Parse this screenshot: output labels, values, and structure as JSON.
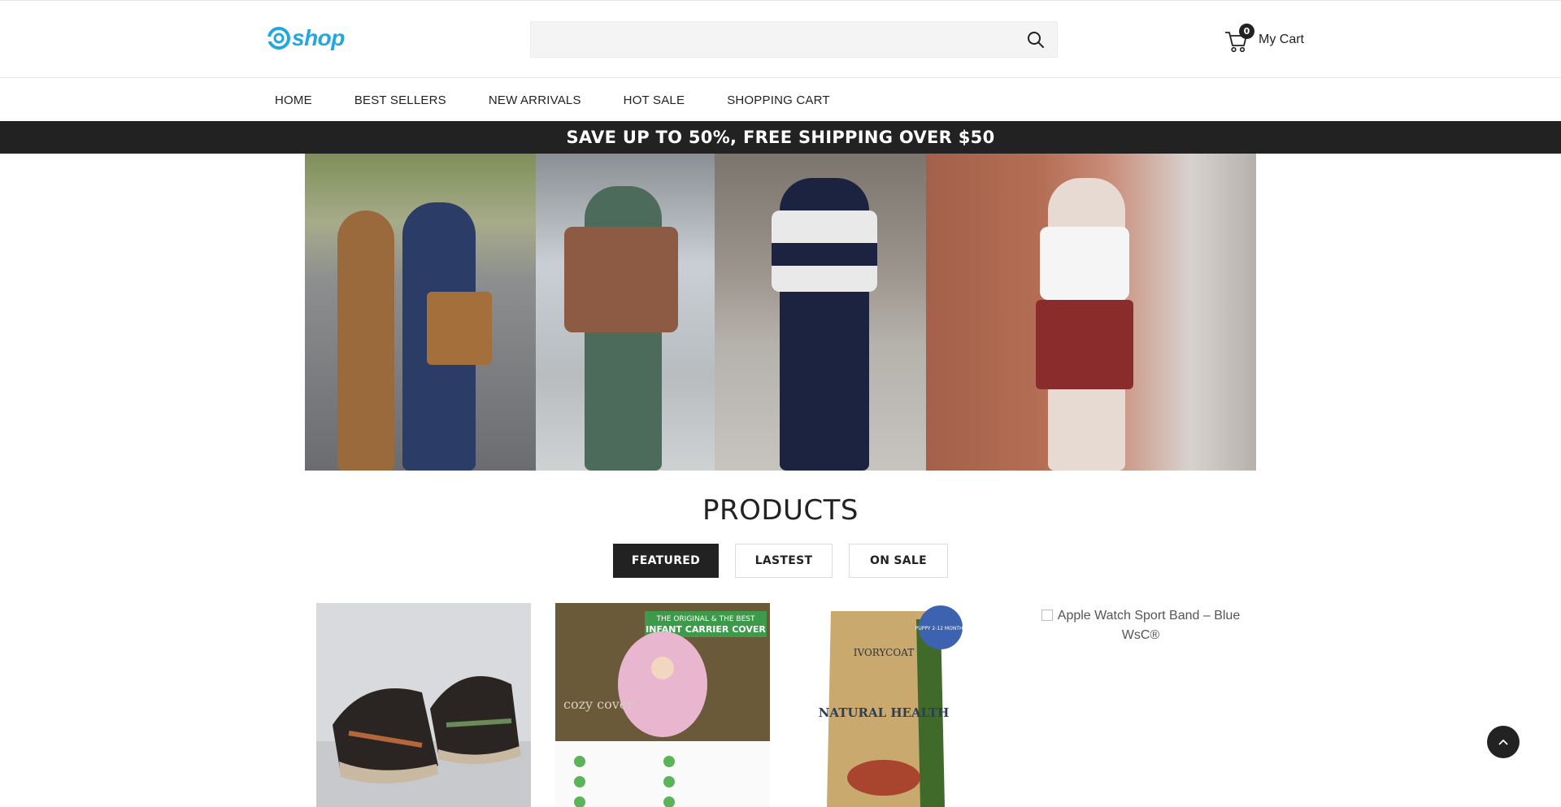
{
  "header": {
    "logo_text": "shop",
    "search": {
      "value": "",
      "placeholder": ""
    },
    "cart": {
      "count": "0",
      "label": "My Cart"
    }
  },
  "nav": {
    "items": [
      {
        "label": "HOME"
      },
      {
        "label": "BEST SELLERS"
      },
      {
        "label": "NEW ARRIVALS"
      },
      {
        "label": "HOT SALE"
      },
      {
        "label": "SHOPPING CART"
      }
    ]
  },
  "promo": {
    "text": "SAVE UP TO 50%, FREE SHIPPING OVER $50"
  },
  "products": {
    "title": "PRODUCTS",
    "tabs": [
      {
        "label": "FEATURED",
        "active": true
      },
      {
        "label": "LASTEST",
        "active": false
      },
      {
        "label": "ON SALE",
        "active": false
      }
    ],
    "cards": [
      {
        "image": "sneakers-photo"
      },
      {
        "image": "infant-carrier-cover-photo",
        "texts": [
          "THE ORIGINAL & THE BEST",
          "INFANT CARRIER COVER",
          "cozy cover"
        ]
      },
      {
        "image": "dog-food-bag-photo",
        "texts": [
          "IVORYCOAT",
          "NATURAL HEALTH",
          "PUPPY 2-12 MONTHS"
        ]
      },
      {
        "alt_text": "Apple Watch Sport Band – Blue WsC®"
      }
    ]
  },
  "colors": {
    "brand": "#22a7e0",
    "dark": "#222222",
    "promo_bg": "#222222"
  }
}
